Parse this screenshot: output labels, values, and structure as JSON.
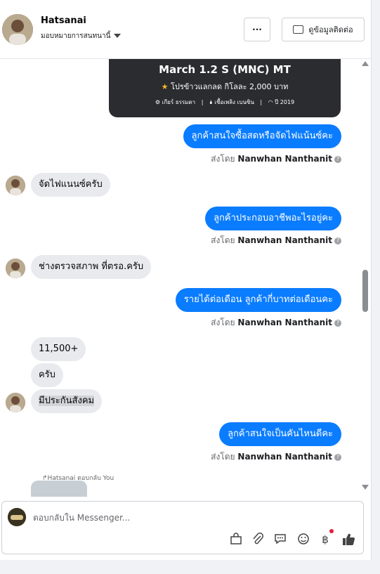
{
  "header": {
    "name": "Hatsanai",
    "assign_label": "มอบหมายการสนทนานี้",
    "more_label": "···",
    "contact_label": "ดูข้อมูลติดต่อ"
  },
  "card": {
    "title": "March 1.2 S (MNC) MT",
    "promo": "โปรข้าวแลกลด กิโลละ 2,000 บาท",
    "spec_transmission": "เกียร์ ธรรมดา",
    "spec_fuel": "เชื้อเพลิง เบนซิน",
    "spec_year": "ปี 2019"
  },
  "messages": {
    "out1": "ลูกค้าสนใจซื้อสดหรือจัดไฟแน้นซ์คะ",
    "in1": "จัดไฟแนนซ์ครับ",
    "out2": "ลูกค้าประกอบอาชีพอะไรอยู่คะ",
    "in2": "ช่างตรวจสภาพ ที่ตรอ.ครับ",
    "out3": "รายได้ต่อเดือน  ลูกค้ากี่บาทต่อเดือนคะ",
    "in3": "11,500+",
    "in4": "ครับ",
    "in5": "มีประกันสังคม",
    "out4": "ลูกค้าสนใจเป็นคันไหนดีคะ",
    "sent_prefix": "ส่งโดย",
    "sender": "Nanwhan Nanthanit",
    "reply_note": "Hatsanai ตอบกลับ You"
  },
  "composer": {
    "placeholder": "ตอบกลับใน Messenger..."
  },
  "icons": [
    "bag-icon",
    "attach-icon",
    "saved-reply-icon",
    "emoji-icon",
    "baht-icon",
    "thumbs-up-icon"
  ],
  "colors": {
    "accent": "#0a7cff",
    "incoming": "#e9eaee"
  }
}
